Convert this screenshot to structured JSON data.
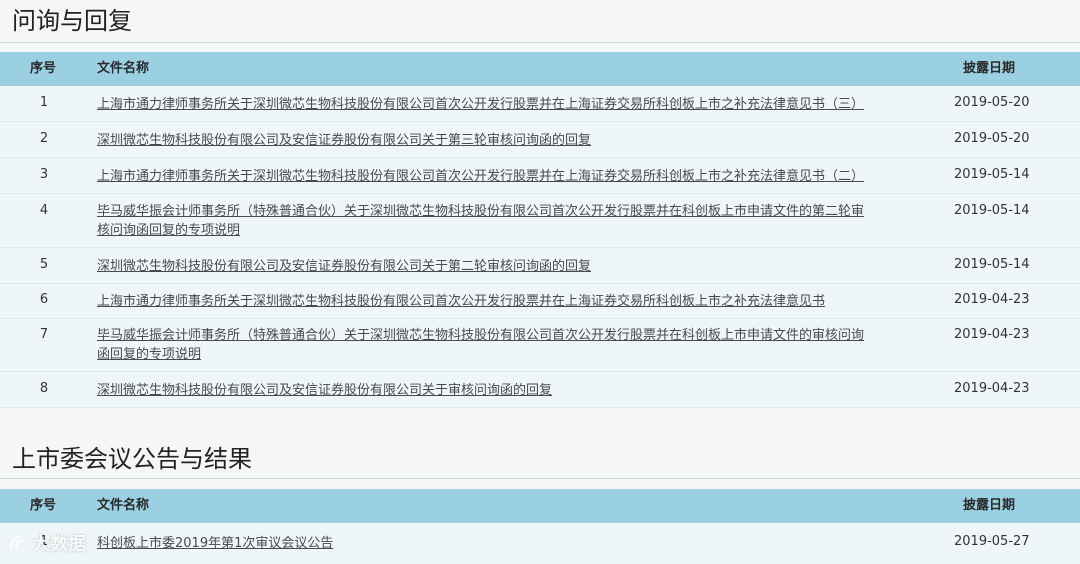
{
  "section1": {
    "title": "问询与回复",
    "headers": {
      "num": "序号",
      "name": "文件名称",
      "date": "披露日期"
    },
    "rows": [
      {
        "num": "1",
        "doc": "上海市通力律师事务所关于深圳微芯生物科技股份有限公司首次公开发行股票并在上海证券交易所科创板上市之补充法律意见书（三）",
        "date": "2019-05-20"
      },
      {
        "num": "2",
        "doc": "深圳微芯生物科技股份有限公司及安信证券股份有限公司关于第三轮审核问询函的回复",
        "date": "2019-05-20"
      },
      {
        "num": "3",
        "doc": "上海市通力律师事务所关于深圳微芯生物科技股份有限公司首次公开发行股票并在上海证券交易所科创板上市之补充法律意见书（二）",
        "date": "2019-05-14"
      },
      {
        "num": "4",
        "doc_line1": "毕马威华振会计师事务所（特殊普通合伙）关于深圳微芯生物科技股份有限公司首次公开发行股票并在科创板上市申请文件的第二轮审",
        "doc_line2": "核问询函回复的专项说明",
        "date": "2019-05-14"
      },
      {
        "num": "5",
        "doc": "深圳微芯生物科技股份有限公司及安信证券股份有限公司关于第二轮审核问询函的回复",
        "date": "2019-05-14"
      },
      {
        "num": "6",
        "doc": "上海市通力律师事务所关于深圳微芯生物科技股份有限公司首次公开发行股票并在上海证券交易所科创板上市之补充法律意见书",
        "date": "2019-04-23"
      },
      {
        "num": "7",
        "doc_line1": "毕马威华振会计师事务所（特殊普通合伙）关于深圳微芯生物科技股份有限公司首次公开发行股票并在科创板上市申请文件的审核问询",
        "doc_line2": "函回复的专项说明",
        "date": "2019-04-23"
      },
      {
        "num": "8",
        "doc": "深圳微芯生物科技股份有限公司及安信证券股份有限公司关于审核问询函的回复",
        "date": "2019-04-23"
      }
    ]
  },
  "section2": {
    "title": "上市委会议公告与结果",
    "headers": {
      "num": "序号",
      "name": "文件名称",
      "date": "披露日期"
    },
    "rows": [
      {
        "num": "1",
        "doc": "科创板上市委2019年第1次审议会议公告",
        "date": "2019-05-27"
      }
    ]
  },
  "watermark": "大数据"
}
